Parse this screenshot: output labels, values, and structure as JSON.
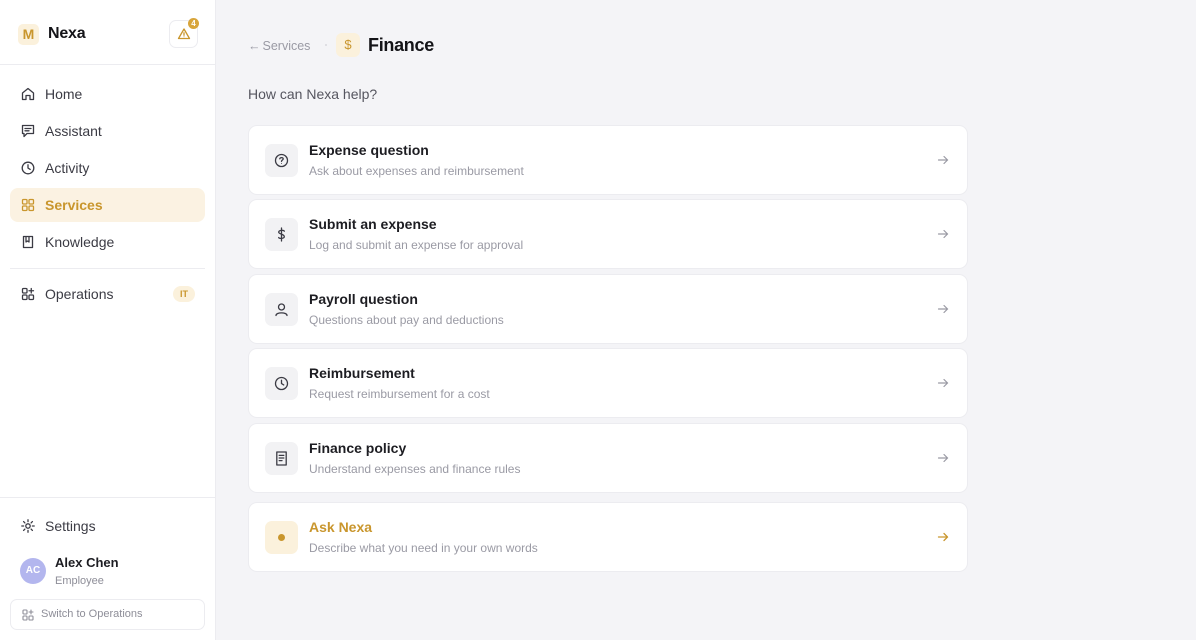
{
  "app": {
    "brand_letter": "M",
    "brand_name": "Nexa",
    "alert_count": "4"
  },
  "sidebar": {
    "nav": [
      {
        "label": "Home",
        "icon": "home-icon"
      },
      {
        "label": "Assistant",
        "icon": "chat-icon"
      },
      {
        "label": "Activity",
        "icon": "clock-icon"
      },
      {
        "label": "Services",
        "icon": "grid-icon",
        "active": true
      },
      {
        "label": "Knowledge",
        "icon": "book-icon"
      }
    ],
    "operations": {
      "label": "Operations",
      "badge": "IT",
      "icon": "operations-icon"
    },
    "settings_label": "Settings",
    "user": {
      "initials": "AC",
      "name": "Alex Chen",
      "role": "Employee"
    },
    "switch_label": "Switch to Operations"
  },
  "header": {
    "back_label": "Services",
    "page_title": "Finance",
    "page_icon_glyph": "$"
  },
  "main": {
    "prompt": "How can Nexa help?",
    "cards": [
      {
        "title": "Expense question",
        "desc": "Ask about expenses and reimbursement",
        "icon": "question-circle-icon"
      },
      {
        "title": "Submit an expense",
        "desc": "Log and submit an expense for approval",
        "icon": "dollar-icon"
      },
      {
        "title": "Payroll question",
        "desc": "Questions about pay and deductions",
        "icon": "person-icon"
      },
      {
        "title": "Reimbursement",
        "desc": "Request reimbursement for a cost",
        "icon": "clock-icon"
      },
      {
        "title": "Finance policy",
        "desc": "Understand expenses and finance rules",
        "icon": "document-icon"
      },
      {
        "title": "Ask Nexa",
        "desc": "Describe what you need in your own words",
        "icon": "dot-icon",
        "accent": true
      }
    ]
  },
  "colors": {
    "accent": "#c9962d",
    "accent_bg": "#fbf1dc",
    "background": "#f4f4f7",
    "avatar": "#b3b6ee"
  }
}
